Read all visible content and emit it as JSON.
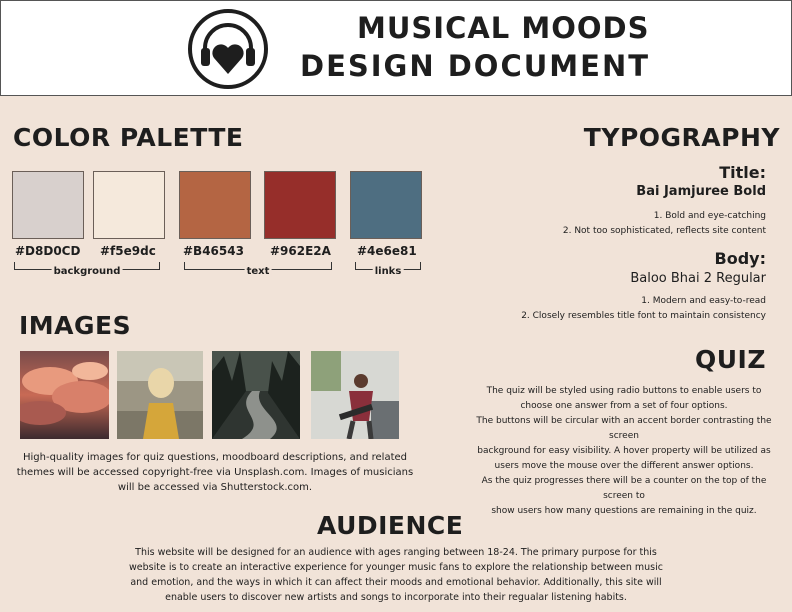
{
  "header": {
    "title_line1": "MUSICAL MOODS",
    "title_line2": "DESIGN DOCUMENT",
    "logo_icon": "heart-headphones-icon"
  },
  "color_palette": {
    "heading": "COLOR PALETTE",
    "swatches": [
      {
        "hex": "#D8D0CD",
        "label": "#D8D0CD"
      },
      {
        "hex": "#f5e9dc",
        "label": "#f5e9dc"
      },
      {
        "hex": "#B46543",
        "label": "#B46543"
      },
      {
        "hex": "#962E2A",
        "label": "#962E2A"
      },
      {
        "hex": "#4e6e81",
        "label": "#4e6e81"
      }
    ],
    "groups": [
      "background",
      "text",
      "links"
    ]
  },
  "images": {
    "heading": "IMAGES",
    "photos": [
      "clouds-photo",
      "woman-laughing-photo",
      "forest-road-photo",
      "guitarist-on-stage-photo"
    ],
    "description": "High-quality images for quiz questions, moodboard descriptions, and related themes will be accessed copyright-free via Unsplash.com. Images of musicians will be accessed via Shutterstock.com."
  },
  "typography": {
    "heading": "TYPOGRAPHY",
    "title_label": "Title:",
    "title_font": "Bai Jamjuree Bold",
    "title_points": [
      "1.     Bold and eye-catching",
      "2.     Not too sophisticated, reflects site content"
    ],
    "body_label": "Body:",
    "body_font": "Baloo Bhai 2 Regular",
    "body_points": [
      "1.     Modern and easy-to-read",
      "2.     Closely resembles title font to maintain consistency"
    ]
  },
  "quiz": {
    "heading": "QUIZ",
    "lines": [
      "The quiz will be styled using radio buttons to enable users to",
      "choose one answer from a set of four options.",
      "The buttons will be circular with an accent border contrasting the screen",
      "background for easy visibility.  A hover property will be utilized as",
      "users move the  mouse over the different answer options.",
      "As the quiz progresses there will be a counter on the top of the screen to",
      "show users how many questions are remaining in the quiz."
    ]
  },
  "audience": {
    "heading": "AUDIENCE",
    "lines": [
      "This website will be designed for an audience with ages ranging between 18-24. The primary purpose for this",
      "website is to create an interactive experience for younger music fans to explore the relationship between music",
      "and emotion, and the ways in which it can affect their moods and emotional behavior. Additionally, this site will",
      "enable users to discover new artists and songs to incorporate into their regualar listening habits."
    ]
  }
}
